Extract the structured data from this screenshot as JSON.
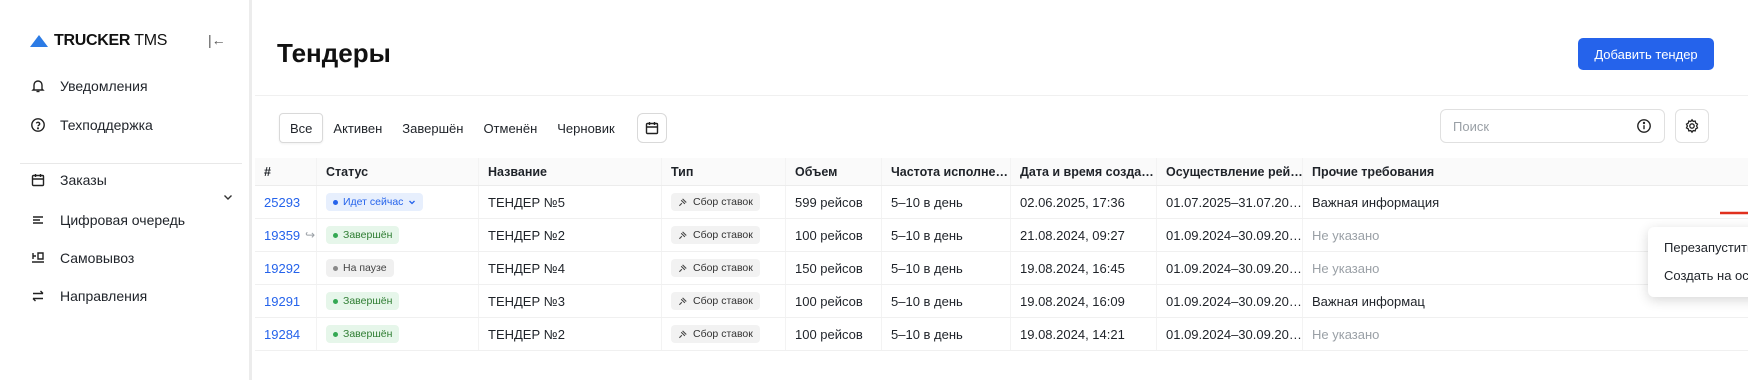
{
  "app": {
    "logo_bold": "TRUCKER",
    "logo_light": "TMS"
  },
  "sidebar": {
    "items": [
      {
        "label": "Уведомления",
        "icon": "bell-icon"
      },
      {
        "label": "Техподдержка",
        "icon": "help-circle-icon"
      },
      {
        "label": "Заказы",
        "icon": "calendar-icon"
      },
      {
        "label": "Цифровая очередь",
        "icon": "queue-icon"
      },
      {
        "label": "Самовывоз",
        "icon": "pickup-icon"
      },
      {
        "label": "Направления",
        "icon": "swap-arrows-icon"
      }
    ]
  },
  "header": {
    "title": "Тендеры",
    "add_button": "Добавить тендер"
  },
  "filters": {
    "tabs": [
      "Все",
      "Активен",
      "Завершён",
      "Отменён",
      "Черновик"
    ],
    "active_tab": "Все"
  },
  "search": {
    "placeholder": "Поиск"
  },
  "table": {
    "columns": [
      "#",
      "Статус",
      "Название",
      "Тип",
      "Объем",
      "Частота исполне…",
      "Дата и время созда…",
      "Осуществление рей…",
      "Прочие требования"
    ],
    "rows": [
      {
        "id": "25293",
        "status": "Идет сейчас",
        "status_color": "blue",
        "name": "ТЕНДЕР №5",
        "type": "Сбор ставок",
        "volume": "599 рейсов",
        "frequency": "5–10 в день",
        "created": "02.06.2025, 17:36",
        "execution": "01.07.2025–31.07.20…",
        "requirements": "Важная информация",
        "req_muted": false,
        "shared": false
      },
      {
        "id": "19359",
        "status": "Завершён",
        "status_color": "green",
        "name": "ТЕНДЕР №2",
        "type": "Сбор ставок",
        "volume": "100 рейсов",
        "frequency": "5–10 в день",
        "created": "21.08.2024, 09:27",
        "execution": "01.09.2024–30.09.20…",
        "requirements": "Не указано",
        "req_muted": true,
        "shared": true
      },
      {
        "id": "19292",
        "status": "На паузе",
        "status_color": "gray",
        "name": "ТЕНДЕР №4",
        "type": "Сбор ставок",
        "volume": "150 рейсов",
        "frequency": "5–10 в день",
        "created": "19.08.2024, 16:45",
        "execution": "01.09.2024–30.09.20…",
        "requirements": "Не указано",
        "req_muted": true,
        "shared": false
      },
      {
        "id": "19291",
        "status": "Завершён",
        "status_color": "green",
        "name": "ТЕНДЕР №3",
        "type": "Сбор ставок",
        "volume": "100 рейсов",
        "frequency": "5–10 в день",
        "created": "19.08.2024, 16:09",
        "execution": "01.09.2024–30.09.20…",
        "requirements": "Важная информац",
        "req_muted": false,
        "shared": false
      },
      {
        "id": "19284",
        "status": "Завершён",
        "status_color": "green",
        "name": "ТЕНДЕР №2",
        "type": "Сбор ставок",
        "volume": "100 рейсов",
        "frequency": "5–10 в день",
        "created": "19.08.2024, 14:21",
        "execution": "01.09.2024–30.09.20…",
        "requirements": "Не указано",
        "req_muted": true,
        "shared": false
      }
    ]
  },
  "context_menu": {
    "items": [
      "Перезапустить",
      "Создать на основе"
    ]
  },
  "colors": {
    "accent": "#2563eb",
    "arrow": "#e0301e"
  }
}
